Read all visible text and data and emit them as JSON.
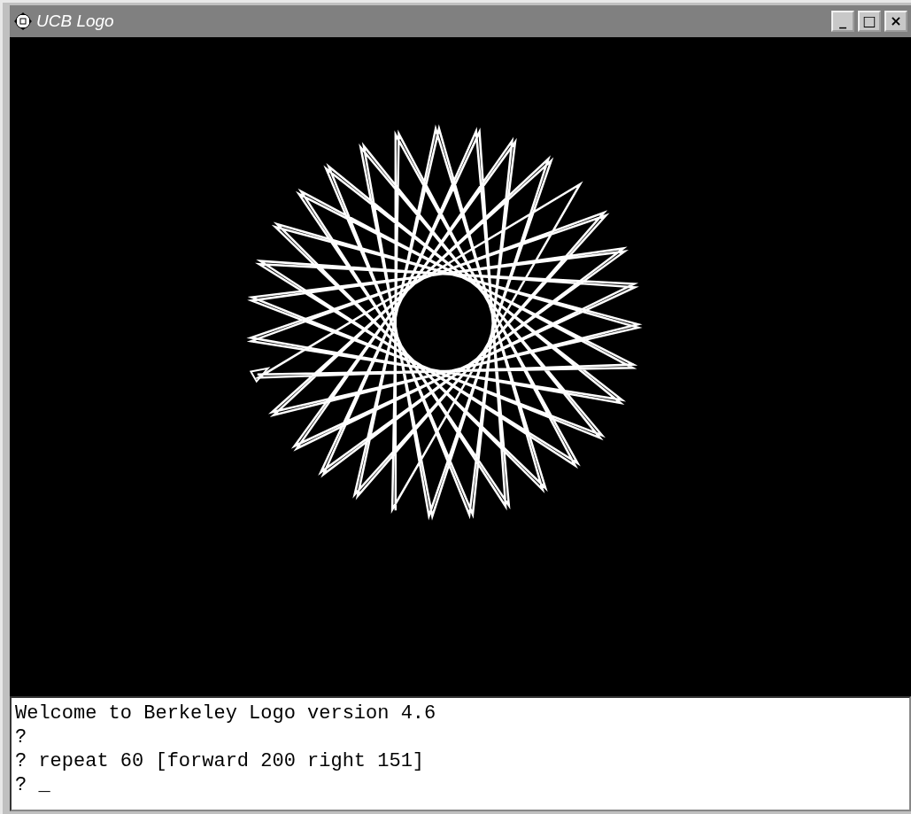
{
  "window": {
    "title": "UCB Logo",
    "controls": [
      "_",
      "□",
      "×"
    ]
  },
  "console": {
    "lines": [
      "Welcome to Berkeley Logo version 4.6",
      "?",
      "? repeat 60 [forward 200 right 151]",
      "? _"
    ]
  }
}
